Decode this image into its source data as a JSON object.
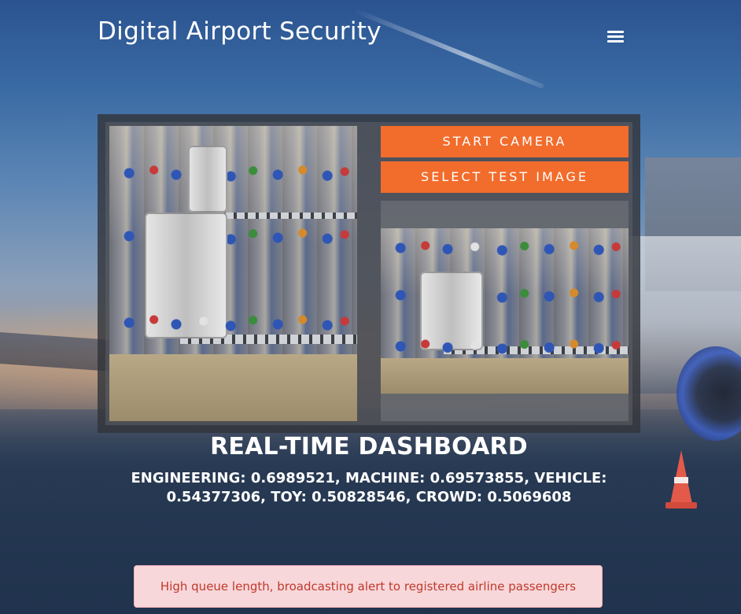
{
  "header": {
    "brand": "Digital Airport Security",
    "menu_icon": "hamburger-menu-icon"
  },
  "controls": {
    "start_camera_label": "START CAMERA",
    "select_test_image_label": "SELECT TEST IMAGE"
  },
  "dashboard": {
    "title": "REAL-TIME DASHBOARD",
    "scores_text": "ENGINEERING: 0.6989521, MACHINE: 0.69573855, VEHICLE: 0.54377306, TOY: 0.50828546, CROWD: 0.5069608",
    "scores": [
      {
        "label": "ENGINEERING",
        "value": 0.6989521
      },
      {
        "label": "MACHINE",
        "value": 0.69573855
      },
      {
        "label": "VEHICLE",
        "value": 0.54377306
      },
      {
        "label": "TOY",
        "value": 0.50828546
      },
      {
        "label": "CROWD",
        "value": 0.5069608
      }
    ]
  },
  "alert": {
    "message": "High queue length, broadcasting alert to registered airline passengers"
  },
  "colors": {
    "accent": "#f26c2c",
    "alert_bg": "#f8d7da",
    "alert_text": "#c0392b"
  }
}
